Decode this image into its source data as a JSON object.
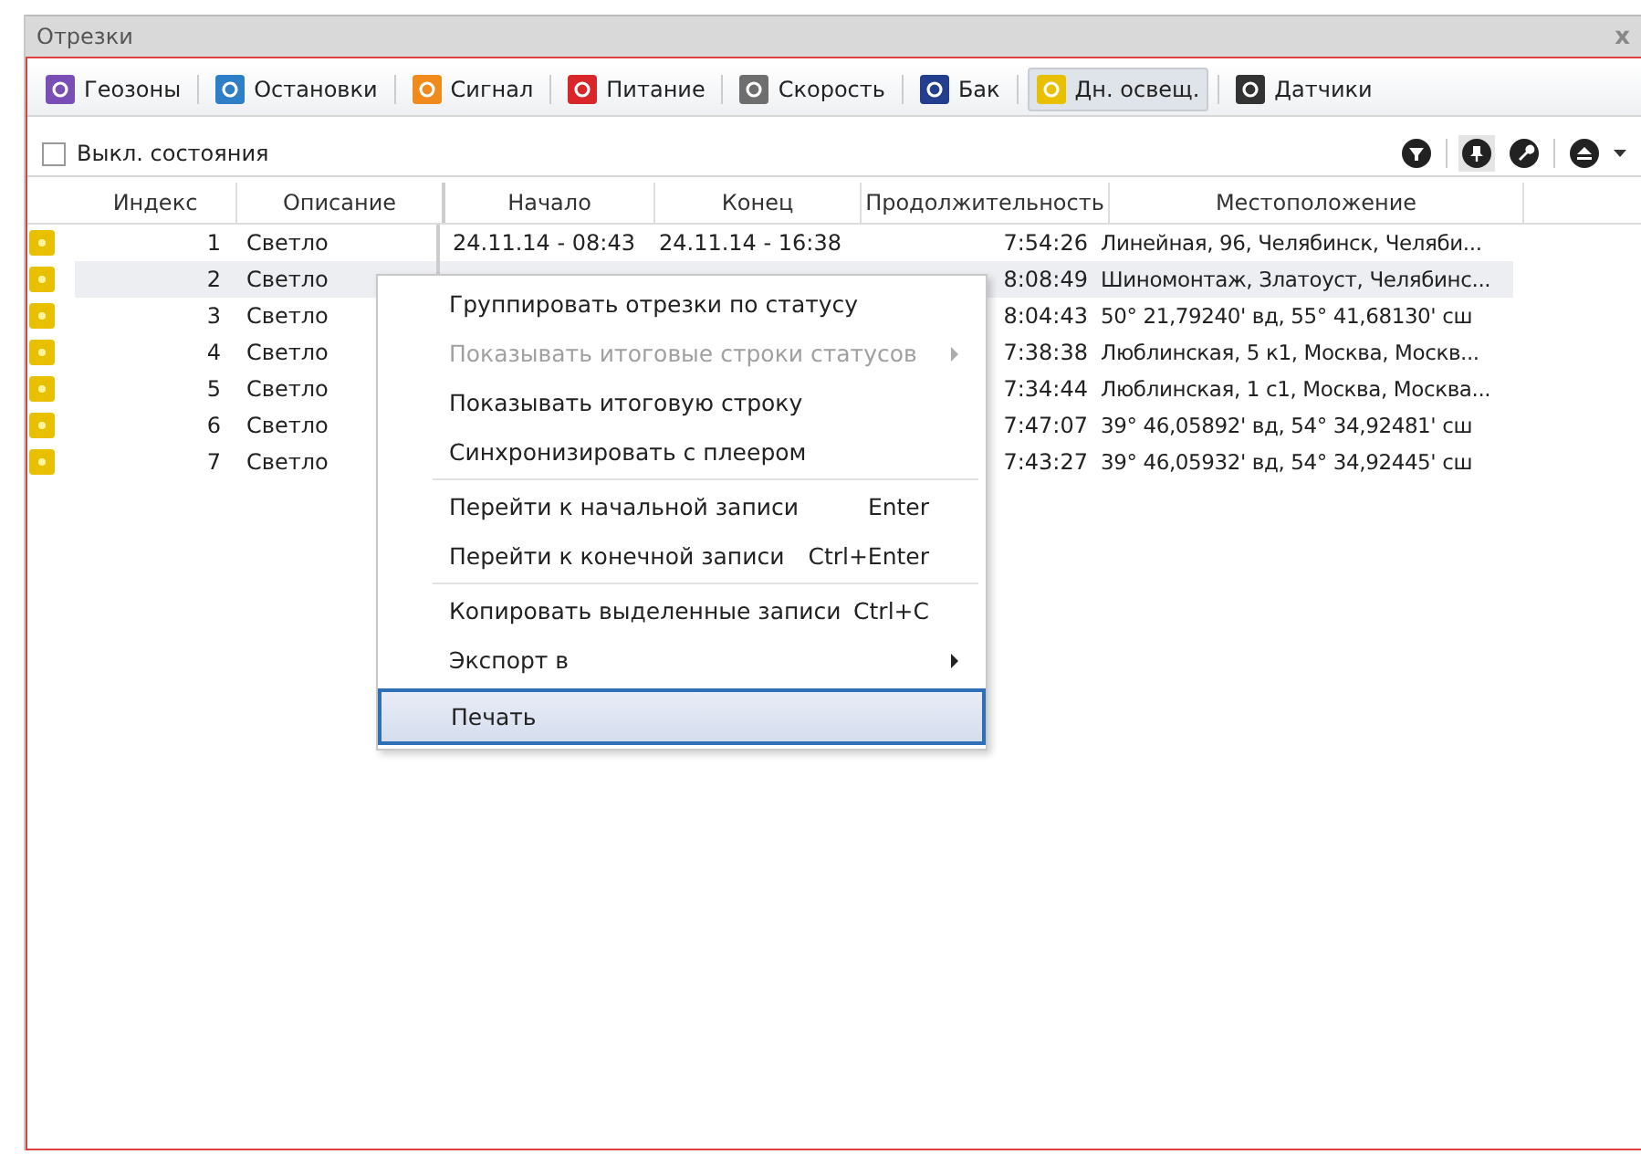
{
  "window": {
    "title": "Отрезки",
    "close": "x"
  },
  "tabs": [
    {
      "label": "Геозоны",
      "color": "#7a4fb5",
      "selected": false
    },
    {
      "label": "Остановки",
      "color": "#2f7fc8",
      "selected": false
    },
    {
      "label": "Сигнал",
      "color": "#f08a1c",
      "selected": false
    },
    {
      "label": "Питание",
      "color": "#d8262a",
      "selected": false
    },
    {
      "label": "Скорость",
      "color": "#6e6e6e",
      "selected": false
    },
    {
      "label": "Бак",
      "color": "#233e8c",
      "selected": false
    },
    {
      "label": "Дн. освещ.",
      "color": "#e8c000",
      "selected": true
    },
    {
      "label": "Датчики",
      "color": "#333333",
      "selected": false
    }
  ],
  "toolbar": {
    "checkbox": {
      "label": "Выкл. состояния",
      "checked": false
    }
  },
  "table": {
    "columns": [
      "Индекс",
      "Описание",
      "Начало",
      "Конец",
      "Продолжительность",
      "Местоположение"
    ],
    "rows": [
      {
        "index": "1",
        "description": "Светло",
        "start": "24.11.14 - 08:43",
        "end": "24.11.14 - 16:38",
        "duration": "7:54:26",
        "location": "Линейная, 96, Челябинск, Челяби...",
        "selected": false
      },
      {
        "index": "2",
        "description": "Светло",
        "duration": "8:08:49",
        "location": "Шиномонтаж, Златоуст, Челябинс...",
        "selected": true
      },
      {
        "index": "3",
        "description": "Светло",
        "duration": "8:04:43",
        "location": "50° 21,79240' вд, 55° 41,68130' сш",
        "selected": false
      },
      {
        "index": "4",
        "description": "Светло",
        "duration": "7:38:38",
        "location": "Люблинская, 5 к1, Москва, Москв...",
        "selected": false
      },
      {
        "index": "5",
        "description": "Светло",
        "duration": "7:34:44",
        "location": "Люблинская, 1 с1, Москва, Москва...",
        "selected": false
      },
      {
        "index": "6",
        "description": "Светло",
        "duration": "7:47:07",
        "location": "39° 46,05892' вд, 54° 34,92481' сш",
        "selected": false
      },
      {
        "index": "7",
        "description": "Светло",
        "duration": "7:43:27",
        "location": "39° 46,05932' вд, 54° 34,92445' сш",
        "selected": false
      }
    ]
  },
  "context_menu": {
    "items": [
      {
        "kind": "item",
        "label": "Группировать отрезки по статусу",
        "disabled": false,
        "submenu": false,
        "selected": false
      },
      {
        "kind": "item",
        "label": "Показывать итоговые строки статусов",
        "disabled": true,
        "submenu": true,
        "selected": false
      },
      {
        "kind": "item",
        "label": "Показывать итоговую строку",
        "disabled": false,
        "submenu": false,
        "selected": false
      },
      {
        "kind": "item",
        "label": "Синхронизировать с плеером",
        "disabled": false,
        "submenu": false,
        "selected": false
      },
      {
        "kind": "separator"
      },
      {
        "kind": "item",
        "label": "Перейти к начальной записи",
        "shortcut": "Enter",
        "disabled": false,
        "submenu": false,
        "selected": false
      },
      {
        "kind": "item",
        "label": "Перейти к конечной записи",
        "shortcut": "Ctrl+Enter",
        "disabled": false,
        "submenu": false,
        "selected": false
      },
      {
        "kind": "separator"
      },
      {
        "kind": "item",
        "label": "Копировать выделенные записи",
        "shortcut": "Ctrl+C",
        "disabled": false,
        "submenu": false,
        "selected": false
      },
      {
        "kind": "item",
        "label": "Экспорт в",
        "disabled": false,
        "submenu": true,
        "selected": false
      },
      {
        "kind": "item",
        "label": "Печать",
        "disabled": false,
        "submenu": false,
        "selected": true
      }
    ]
  }
}
